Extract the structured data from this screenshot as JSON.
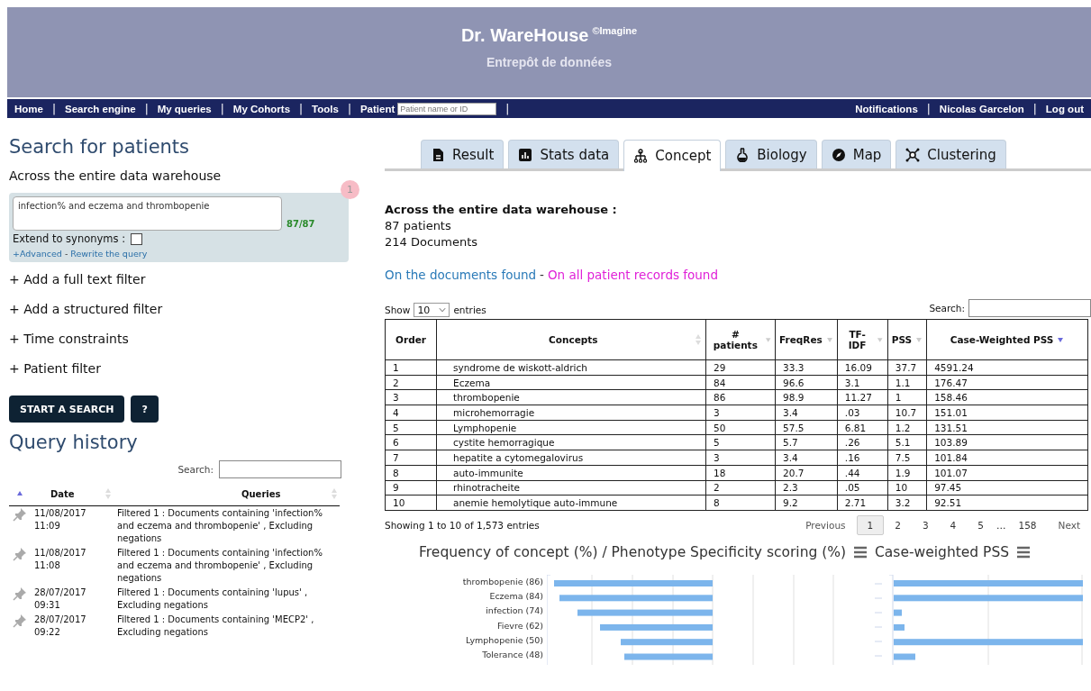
{
  "header": {
    "title": "Dr. WareHouse",
    "mark": "©Imagine",
    "subtitle": "Entrepôt de données"
  },
  "nav": {
    "left": [
      {
        "label": "Home",
        "kind": "link"
      },
      {
        "label": "|",
        "kind": "separator"
      },
      {
        "label": "Search engine",
        "kind": "link"
      },
      {
        "label": "|",
        "kind": "separator"
      },
      {
        "label": "My queries",
        "kind": "link"
      },
      {
        "label": "|",
        "kind": "separator"
      },
      {
        "label": "My Cohorts",
        "kind": "link"
      },
      {
        "label": "|",
        "kind": "separator"
      },
      {
        "label": "Tools",
        "kind": "link"
      },
      {
        "label": "|",
        "kind": "separator"
      }
    ],
    "patient": {
      "label": "Patient",
      "placeholder": "Patient name or ID",
      "separator": "|"
    },
    "right": [
      {
        "label": "Notifications",
        "kind": "link"
      },
      {
        "label": "|",
        "kind": "separator"
      },
      {
        "label": "Nicolas Garcelon",
        "kind": "link"
      },
      {
        "label": "|",
        "kind": "separator"
      },
      {
        "label": "Log out",
        "kind": "link"
      }
    ]
  },
  "search": {
    "title": "Search for patients",
    "scope": "Across the entire data warehouse",
    "badge": "1",
    "query": "infection% and eczema and thrombopenie",
    "count": "87/87",
    "synonyms": {
      "label": "Extend to synonyms :",
      "checked": false
    },
    "advanced": "+Advanced",
    "separator": "-",
    "rewrite": "Rewrite the query",
    "filters": [
      "+ Add a full text filter",
      "+ Add a structured filter",
      "+ Time constraints",
      "+ Patient filter"
    ],
    "buttons": [
      {
        "label": "START A SEARCH"
      },
      {
        "label": "?"
      }
    ]
  },
  "history": {
    "title": "Query history",
    "search_label": "Search:",
    "columns": [
      {
        "kind": "ascending"
      },
      {
        "label": "Date",
        "kind": "sortable"
      },
      {
        "label": "Queries",
        "kind": "sortable"
      }
    ],
    "rows": [
      {
        "date": "11/08/2017 11:09",
        "query": "Filtered 1 : Documents containing 'infection% and eczema and thrombopenie' , Excluding negations"
      },
      {
        "date": "11/08/2017 11:08",
        "query": "Filtered 1 : Documents containing 'infection% and eczema and thrombopenie' , Excluding negations"
      },
      {
        "date": "28/07/2017 09:31",
        "query": "Filtered 1 : Documents containing 'lupus' , Excluding negations"
      },
      {
        "date": "28/07/2017 09:22",
        "query": "Filtered 1 : Documents containing 'MECP2' , Excluding negations"
      }
    ]
  },
  "tabs": [
    {
      "label": "Result",
      "kind": "document",
      "selected": false
    },
    {
      "label": "Stats data",
      "kind": "stats",
      "selected": false
    },
    {
      "label": "Concept",
      "kind": "tree",
      "selected": true
    },
    {
      "label": "Biology",
      "kind": "flask",
      "selected": false
    },
    {
      "label": "Map",
      "kind": "compass",
      "selected": false
    },
    {
      "label": "Clustering",
      "kind": "cluster",
      "selected": false
    }
  ],
  "summary": {
    "title": "Across the entire data warehouse :",
    "patients": "87 patients",
    "documents": "214 Documents"
  },
  "scope_links": [
    {
      "label": "On the documents found",
      "kind": "documents"
    },
    {
      "label": "-",
      "kind": "separator"
    },
    {
      "label": "On all patient records found",
      "kind": "records"
    }
  ],
  "table": {
    "show": "Show",
    "page_size": "10",
    "entries": "entries",
    "search_label": "Search:",
    "columns": [
      {
        "label": "Order",
        "kind": "plain"
      },
      {
        "label": "Concepts",
        "kind": "sortable"
      },
      {
        "label": "# patients",
        "kind": "descending"
      },
      {
        "label": "FreqRes",
        "kind": "descending"
      },
      {
        "label": "TF-IDF",
        "kind": "descending"
      },
      {
        "label": "PSS",
        "kind": "descending"
      },
      {
        "label": "Case-Weighted PSS",
        "kind": "sorted"
      }
    ],
    "rows": [
      [
        "1",
        "syndrome de wiskott-aldrich",
        "29",
        "33.3",
        "16.09",
        "37.7",
        "4591.24"
      ],
      [
        "2",
        "Eczema",
        "84",
        "96.6",
        "3.1",
        "1.1",
        "176.47"
      ],
      [
        "3",
        "thrombopenie",
        "86",
        "98.9",
        "11.27",
        "1",
        "158.46"
      ],
      [
        "4",
        "microhemorragie",
        "3",
        "3.4",
        ".03",
        "10.7",
        "151.01"
      ],
      [
        "5",
        "Lymphopenie",
        "50",
        "57.5",
        "6.81",
        "1.2",
        "131.51"
      ],
      [
        "6",
        "cystite hemorragique",
        "5",
        "5.7",
        ".26",
        "5.1",
        "103.89"
      ],
      [
        "7",
        "hepatite a cytomegalovirus",
        "3",
        "3.4",
        ".16",
        "7.5",
        "101.84"
      ],
      [
        "8",
        "auto-immunite",
        "18",
        "20.7",
        ".44",
        "1.9",
        "101.07"
      ],
      [
        "9",
        "rhinotracheite",
        "2",
        "2.3",
        ".05",
        "10",
        "97.45"
      ],
      [
        "10",
        "anemie hemolytique auto-immune",
        "8",
        "9.2",
        "2.71",
        "3.2",
        "92.51"
      ]
    ],
    "info": "Showing 1 to 10 of 1,573 entries",
    "pager": [
      {
        "label": "Previous",
        "kind": "nav",
        "selected": false
      },
      {
        "label": "1",
        "kind": "page",
        "selected": true
      },
      {
        "label": "2",
        "kind": "page",
        "selected": false
      },
      {
        "label": "3",
        "kind": "page",
        "selected": false
      },
      {
        "label": "4",
        "kind": "page",
        "selected": false
      },
      {
        "label": "5",
        "kind": "page",
        "selected": false
      },
      {
        "label": "…",
        "kind": "gap"
      },
      {
        "label": "158",
        "kind": "page",
        "selected": false
      },
      {
        "label": "Next",
        "kind": "nav",
        "selected": false
      }
    ]
  },
  "charts": [
    {
      "title": "Frequency of concept (%) / Phenotype Specificity scoring (%)",
      "labels": [
        "thrombopenie (86)",
        "Eczema (84)",
        "infection (74)",
        "Fievre (62)",
        "Lymphopenie (50)",
        "Tolerance (48)"
      ]
    },
    {
      "title": "Case-weighted PSS"
    }
  ]
}
